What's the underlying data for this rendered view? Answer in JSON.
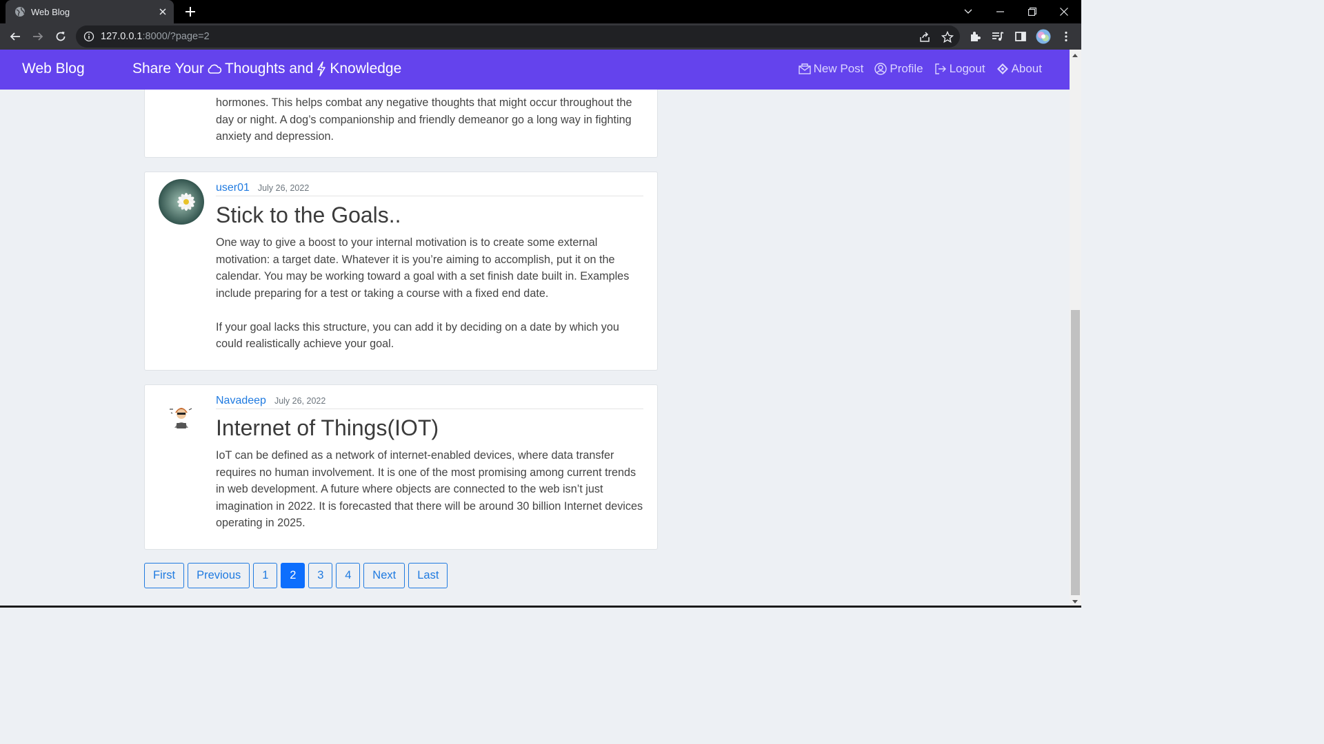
{
  "browser": {
    "tab_title": "Web Blog",
    "url_host": "127.0.0.1",
    "url_rest": ":8000/?page=2"
  },
  "navbar": {
    "brand": "Web Blog",
    "tagline_part1": "Share Your",
    "tagline_part2": "Thoughts and",
    "tagline_part3": "Knowledge",
    "links": {
      "new_post": "New Post",
      "profile": "Profile",
      "logout": "Logout",
      "about": "About"
    },
    "color": "#6443ed"
  },
  "posts": [
    {
      "body": [
        "hormones. This helps combat any negative thoughts that might occur throughout the day or night. A dog’s companionship and friendly demeanor go a long way in fighting anxiety and depression."
      ]
    },
    {
      "author": "user01",
      "date": "July 26, 2022",
      "title": "Stick to the Goals..",
      "avatar": "daisy-avatar",
      "body": [
        "One way to give a boost to your internal motivation is to create some external motivation: a target date. Whatever it is you’re aiming to accomplish, put it on the calendar. You may be working toward a goal with a set finish date built in. Examples include preparing for a test or taking a course with a fixed end date.",
        "If your goal lacks this structure, you can add it by deciding on a date by which you could realistically achieve your goal."
      ]
    },
    {
      "author": "Navadeep",
      "date": "July 26, 2022",
      "title": "Internet of Things(IOT)",
      "avatar": "hacker-avatar",
      "body": [
        "IoT can be defined as a network of internet-enabled devices, where data transfer requires no human involvement. It is one of the most promising among current trends in web development. A future where objects are connected to the web isn’t just imagination in 2022. It is forecasted that there will be around 30 billion Internet devices operating in 2025."
      ]
    }
  ],
  "pagination": {
    "first": "First",
    "previous": "Previous",
    "pages": [
      "1",
      "2",
      "3",
      "4"
    ],
    "current": "2",
    "next": "Next",
    "last": "Last"
  }
}
